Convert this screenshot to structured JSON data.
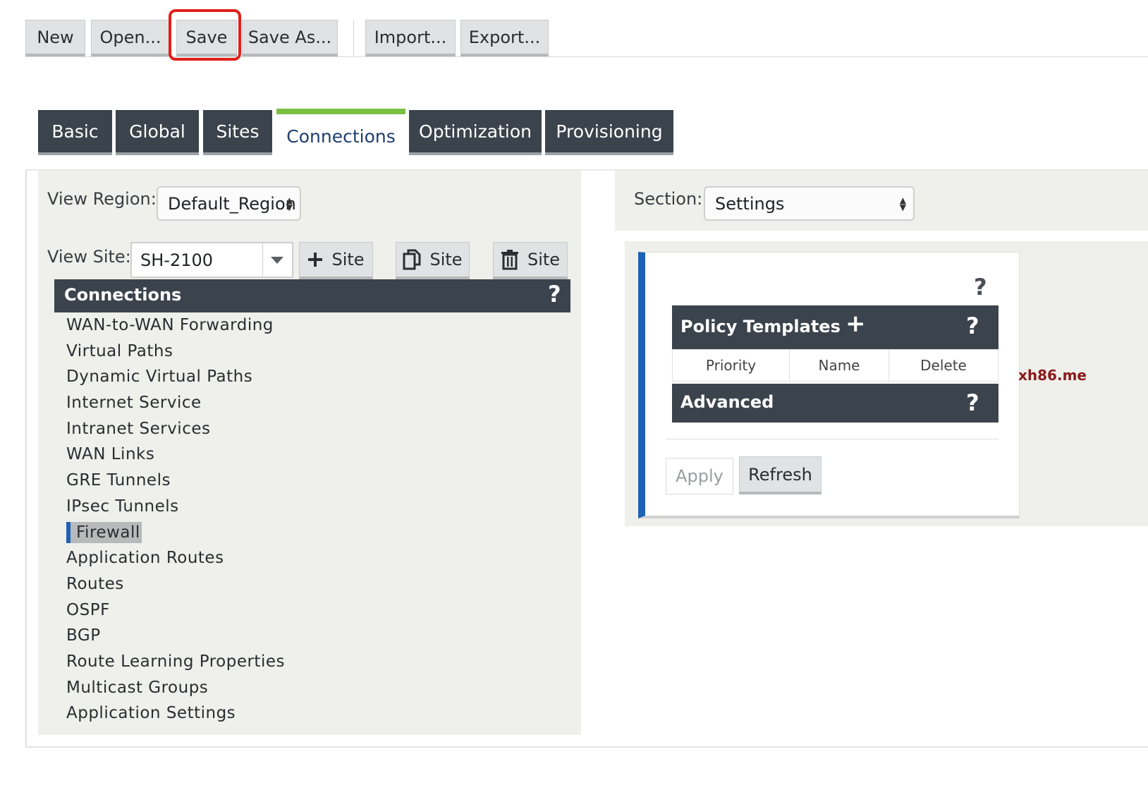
{
  "toolbar": {
    "buttons": [
      {
        "label": "New"
      },
      {
        "label": "Open..."
      },
      {
        "label": "Save"
      },
      {
        "label": "Save As..."
      },
      {
        "label": "Import..."
      },
      {
        "label": "Export..."
      }
    ],
    "highlighted": "Save",
    "highlight_color": "#e0201a"
  },
  "tabs": [
    {
      "label": "Basic"
    },
    {
      "label": "Global"
    },
    {
      "label": "Sites"
    },
    {
      "label": "Connections",
      "active": true
    },
    {
      "label": "Optimization"
    },
    {
      "label": "Provisioning"
    }
  ],
  "left": {
    "view_region_label": "View Region:",
    "view_region_value": "Default_Region",
    "view_site_label": "View Site:",
    "view_site_value": "SH-2100",
    "site_buttons": [
      {
        "icon": "plus-icon",
        "label": "Site"
      },
      {
        "icon": "copy-icon",
        "label": "Site"
      },
      {
        "icon": "trash-icon",
        "label": "Site"
      }
    ],
    "connections_header": "Connections",
    "help_mark": "?",
    "items": [
      "WAN-to-WAN Forwarding",
      "Virtual Paths",
      "Dynamic Virtual Paths",
      "Internet Service",
      "Intranet Services",
      "WAN Links",
      "GRE Tunnels",
      "IPsec Tunnels",
      "Firewall",
      "Application Routes",
      "Routes",
      "OSPF",
      "BGP",
      "Route Learning Properties",
      "Multicast Groups",
      "Application Settings"
    ],
    "selected_item": "Firewall"
  },
  "right": {
    "section_label": "Section:",
    "section_value": "Settings",
    "help_mark": "?",
    "policy_templates_title": "Policy Templates",
    "add_symbol": "+",
    "columns": [
      "Priority",
      "Name",
      "Delete"
    ],
    "advanced_title": "Advanced",
    "apply_label": "Apply",
    "refresh_label": "Refresh"
  },
  "watermark": "xh86.me",
  "colors": {
    "dark": "#3b434c",
    "accent_blue": "#1d62b5",
    "active_tab_green": "#7ac143",
    "panel_bg": "#efefeb"
  }
}
